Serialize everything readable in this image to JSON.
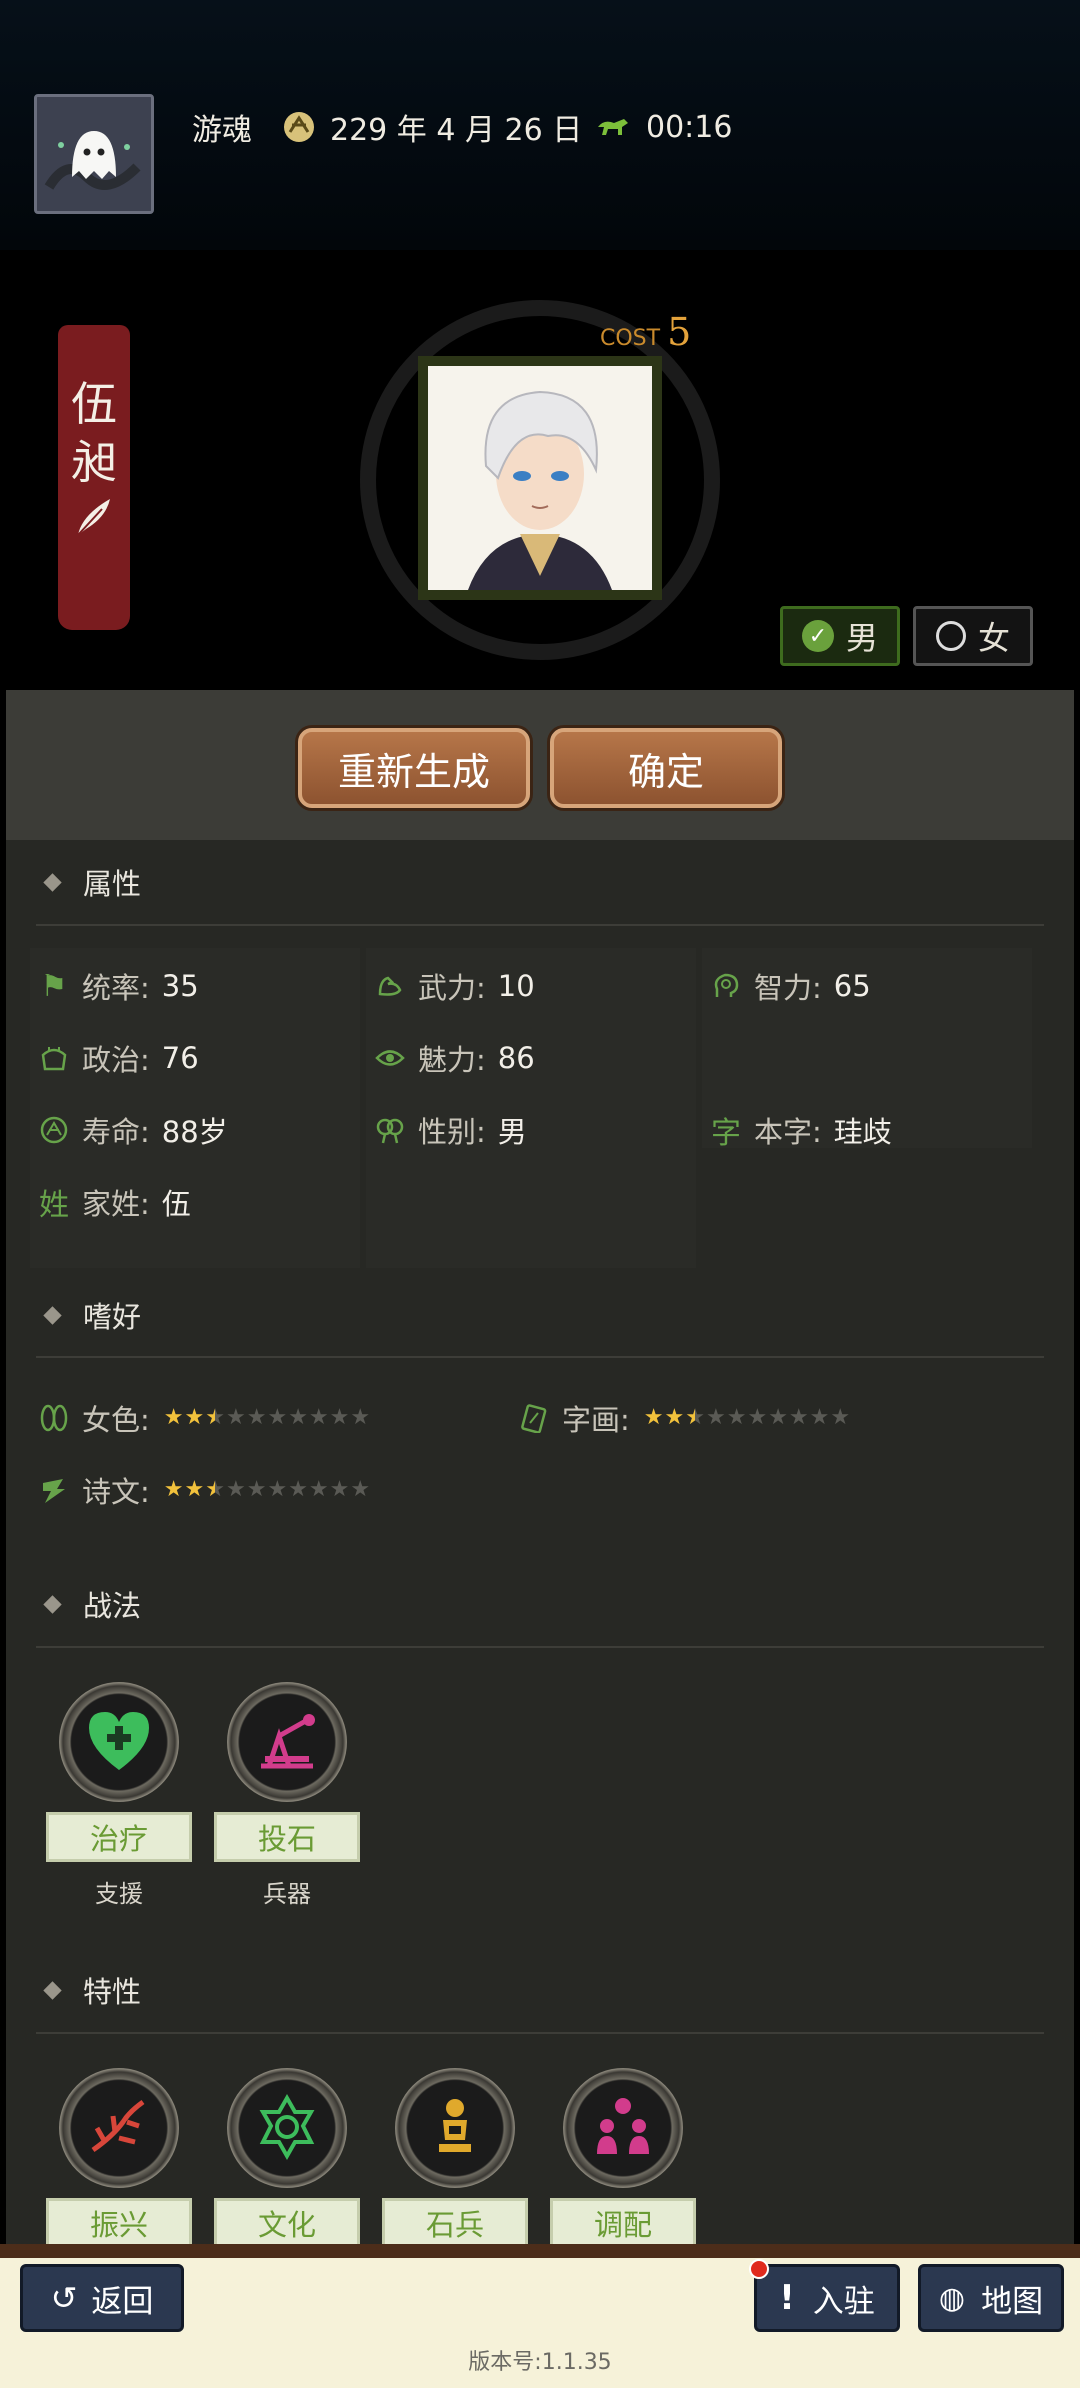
{
  "header": {
    "user_name": "游魂",
    "date": "229 年 4 月 26 日",
    "time": "00:16"
  },
  "character": {
    "name_chars": [
      "伍",
      "昶"
    ],
    "cost_label": "COST",
    "cost_value": "5"
  },
  "gender": {
    "male": "男",
    "female": "女",
    "selected": "male"
  },
  "actions": {
    "regenerate": "重新生成",
    "confirm": "确定"
  },
  "sections": {
    "attributes": "属性",
    "hobbies": "嗜好",
    "tactics": "战法",
    "traits": "特性"
  },
  "attributes": [
    {
      "label": "统率:",
      "value": "35",
      "icon": "flag-icon"
    },
    {
      "label": "武力:",
      "value": "10",
      "icon": "muscle-icon"
    },
    {
      "label": "智力:",
      "value": "65",
      "icon": "brain-icon"
    },
    {
      "label": "政治:",
      "value": "76",
      "icon": "politics-icon"
    },
    {
      "label": "魅力:",
      "value": "86",
      "icon": "eye-icon"
    },
    {
      "label": "寿命:",
      "value": "88岁",
      "icon": "lifespan-icon"
    },
    {
      "label": "性别:",
      "value": "男",
      "icon": "gender-icon"
    },
    {
      "label": "本字:",
      "value": "珪歧",
      "icon": "zi-icon",
      "glyph": "字"
    },
    {
      "label": "家姓:",
      "value": "伍",
      "icon": "surname-icon",
      "glyph": "姓"
    }
  ],
  "hobbies": [
    {
      "label": "女色:",
      "rating": 2.5,
      "max": 10,
      "icon": "slippers-icon"
    },
    {
      "label": "字画:",
      "rating": 2.5,
      "max": 10,
      "icon": "painting-icon"
    },
    {
      "label": "诗文:",
      "rating": 2.5,
      "max": 10,
      "icon": "scroll-icon"
    }
  ],
  "tactics": [
    {
      "name": "治疗",
      "category": "支援",
      "icon": "heal-heart-icon"
    },
    {
      "name": "投石",
      "category": "兵器",
      "icon": "catapult-icon"
    }
  ],
  "traits": [
    {
      "name": "振兴",
      "icon": "revive-icon"
    },
    {
      "name": "文化",
      "icon": "culture-icon"
    },
    {
      "name": "石兵",
      "icon": "stone-soldier-icon"
    },
    {
      "name": "调配",
      "icon": "dispatch-icon"
    }
  ],
  "footer": {
    "back": "返回",
    "station": "入驻",
    "map": "地图",
    "version": "版本号:1.1.35"
  },
  "colors": {
    "accent_green": "#67a34a",
    "banner_red": "#7a1c1f",
    "button_brown": "#a0623a",
    "star_gold": "#f2c23c"
  }
}
